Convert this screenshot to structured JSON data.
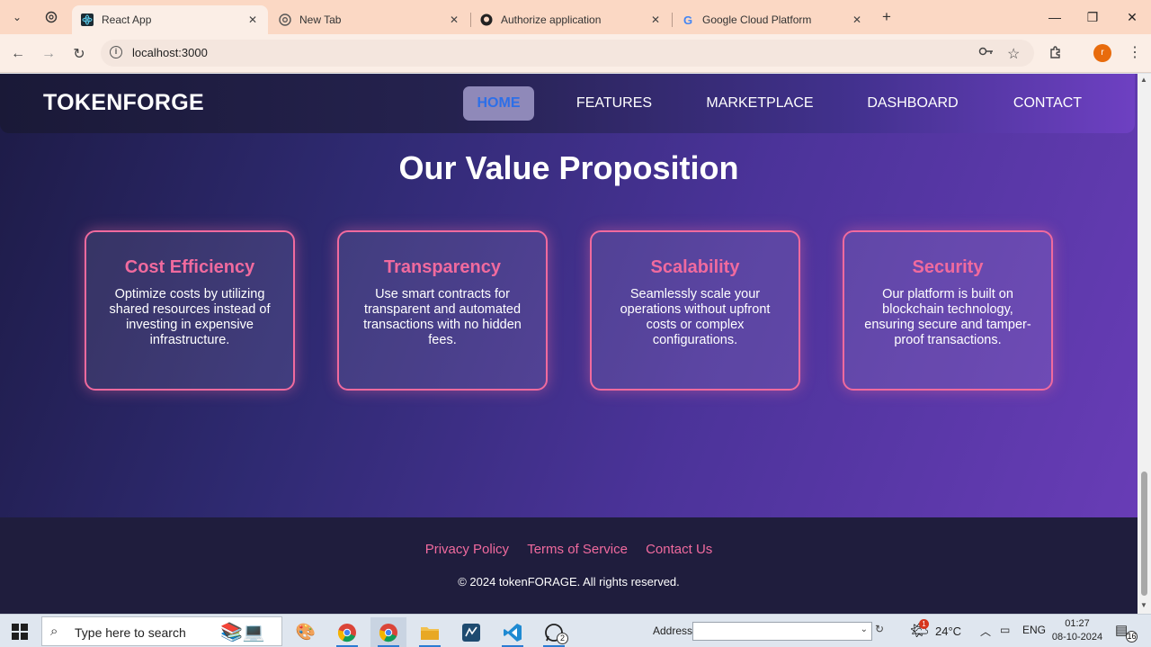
{
  "browser": {
    "tabs": [
      {
        "title": "React App",
        "active": true
      },
      {
        "title": "New Tab",
        "active": false
      },
      {
        "title": "Authorize application",
        "active": false
      },
      {
        "title": "Google Cloud Platform",
        "active": false
      }
    ],
    "new_tab": "+",
    "url": "localhost:3000",
    "profile_initial": "r",
    "profile_color": "#e86b0c"
  },
  "site": {
    "brand": "TOKENFORGE",
    "nav": [
      "HOME",
      "FEATURES",
      "MARKETPLACE",
      "DASHBOARD",
      "CONTACT"
    ],
    "active_nav": "HOME",
    "section_title": "Our Value Proposition",
    "cards": [
      {
        "title": "Cost Efficiency",
        "text": "Optimize costs by utilizing shared resources instead of investing in expensive infrastructure."
      },
      {
        "title": "Transparency",
        "text": "Use smart contracts for transparent and automated transactions with no hidden fees."
      },
      {
        "title": "Scalability",
        "text": "Seamlessly scale your operations without upfront costs or complex configurations."
      },
      {
        "title": "Security",
        "text": "Our platform is built on blockchain technology, ensuring secure and tamper-proof transactions."
      }
    ],
    "footer_links": [
      "Privacy Policy",
      "Terms of Service",
      "Contact Us"
    ],
    "copyright": "© 2024 tokenFORAGE. All rights reserved.",
    "accent_color": "#f06a9e"
  },
  "taskbar": {
    "search_placeholder": "Type here to search",
    "address_label": "Address",
    "weather_badge": "1",
    "temperature": "24°C",
    "language": "ENG",
    "time": "01:27",
    "date": "08-10-2024",
    "notification_count": "16",
    "whatsapp_badge": "2"
  }
}
